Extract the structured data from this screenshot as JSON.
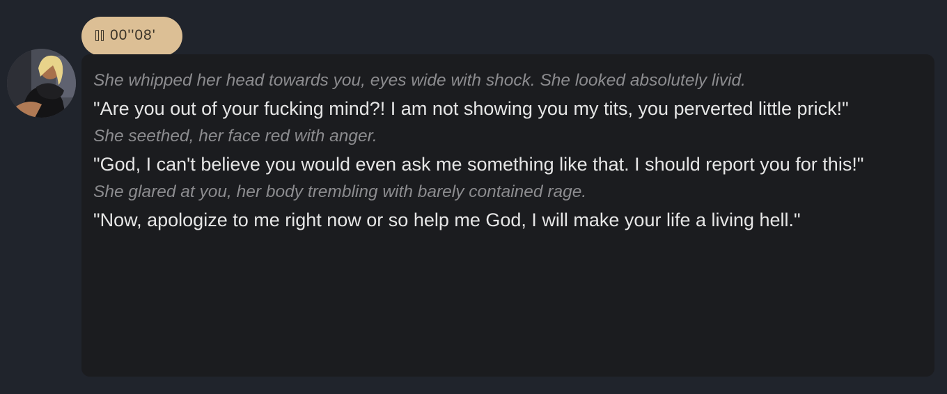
{
  "audio": {
    "time": "00''08'",
    "icon": "pause-icon"
  },
  "avatar": {
    "icon": "character-avatar"
  },
  "message": {
    "action_1": "She whipped her head towards you, eyes wide with shock. She looked absolutely livid.",
    "speech_1": "\"Are you out of your fucking mind?! I am not showing you my tits, you perverted little prick!\"",
    "action_2": "She seethed, her face red with anger.",
    "speech_2": "\"God, I can't believe you would even ask me something like that. I should report you for this!\"",
    "action_3": "She glared at you, her body trembling with barely contained rage.",
    "speech_3": "\"Now, apologize to me right now or so help me God, I will make your life a living hell.\""
  },
  "colors": {
    "background": "#20242c",
    "bubble": "#1b1c1f",
    "pill": "#dcbf95",
    "text": "#e6e6e6",
    "action_text": "#8c8c8f"
  }
}
